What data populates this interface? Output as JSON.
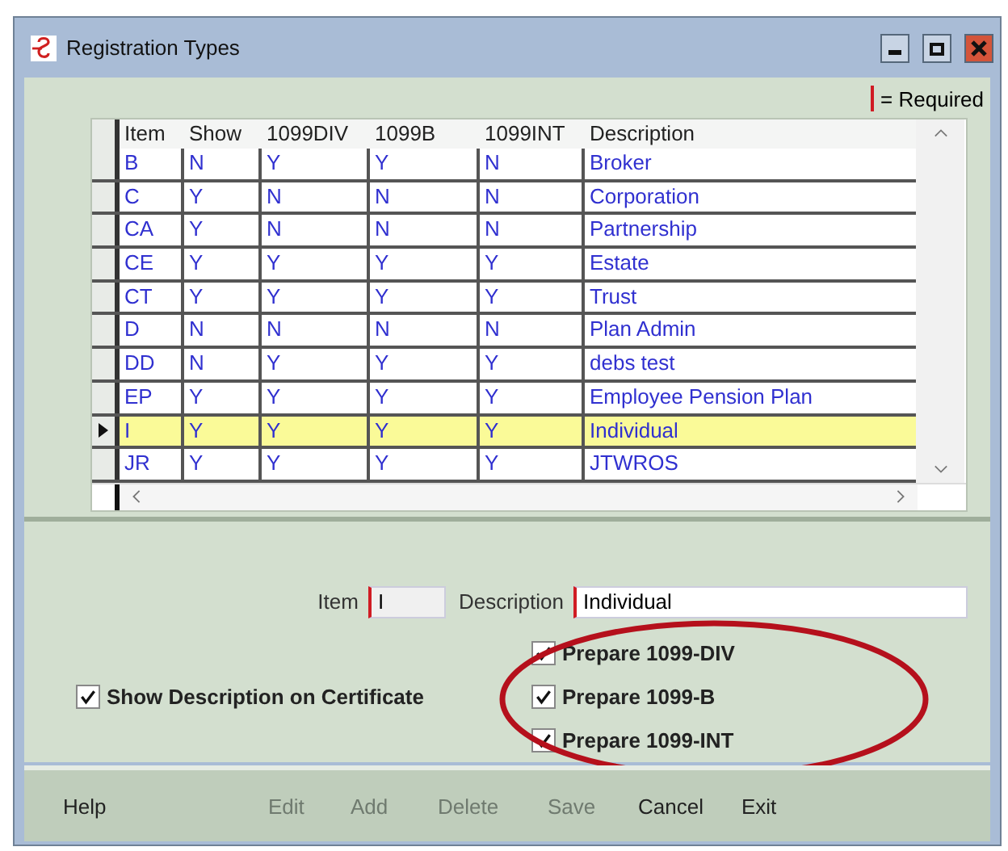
{
  "window": {
    "title": "Registration Types"
  },
  "legend": {
    "label": "= Required"
  },
  "table": {
    "columns": [
      "Item",
      "Show",
      "1099DIV",
      "1099B",
      "1099INT",
      "Description"
    ],
    "rows": [
      {
        "cells": [
          "B",
          "N",
          "Y",
          "Y",
          "N",
          "Broker"
        ],
        "selected": false
      },
      {
        "cells": [
          "C",
          "Y",
          "N",
          "N",
          "N",
          "Corporation"
        ],
        "selected": false
      },
      {
        "cells": [
          "CA",
          "Y",
          "N",
          "N",
          "N",
          "Partnership"
        ],
        "selected": false
      },
      {
        "cells": [
          "CE",
          "Y",
          "Y",
          "Y",
          "Y",
          "Estate"
        ],
        "selected": false
      },
      {
        "cells": [
          "CT",
          "Y",
          "Y",
          "Y",
          "Y",
          "Trust"
        ],
        "selected": false
      },
      {
        "cells": [
          "D",
          "N",
          "N",
          "N",
          "N",
          "Plan Admin"
        ],
        "selected": false
      },
      {
        "cells": [
          "DD",
          "N",
          "Y",
          "Y",
          "Y",
          "debs test"
        ],
        "selected": false
      },
      {
        "cells": [
          "EP",
          "Y",
          "Y",
          "Y",
          "Y",
          "Employee Pension Plan"
        ],
        "selected": false
      },
      {
        "cells": [
          "I",
          "Y",
          "Y",
          "Y",
          "Y",
          "Individual"
        ],
        "selected": true
      },
      {
        "cells": [
          "JR",
          "Y",
          "Y",
          "Y",
          "Y",
          "JTWROS"
        ],
        "selected": false
      }
    ]
  },
  "form": {
    "item": {
      "label": "Item",
      "value": "I"
    },
    "description": {
      "label": "Description",
      "value": "Individual"
    },
    "show_description": {
      "label": "Show Description on Certificate",
      "checked": true
    },
    "prepare": [
      {
        "label": "Prepare 1099-DIV",
        "checked": true
      },
      {
        "label": "Prepare 1099-B",
        "checked": true
      },
      {
        "label": "Prepare 1099-INT",
        "checked": true
      }
    ]
  },
  "buttons": [
    {
      "label": "Help",
      "disabled": false
    },
    {
      "label": "Edit",
      "disabled": true
    },
    {
      "label": "Add",
      "disabled": true
    },
    {
      "label": "Delete",
      "disabled": true
    },
    {
      "label": "Save",
      "disabled": true
    },
    {
      "label": "Cancel",
      "disabled": false
    },
    {
      "label": "Exit",
      "disabled": false
    }
  ]
}
